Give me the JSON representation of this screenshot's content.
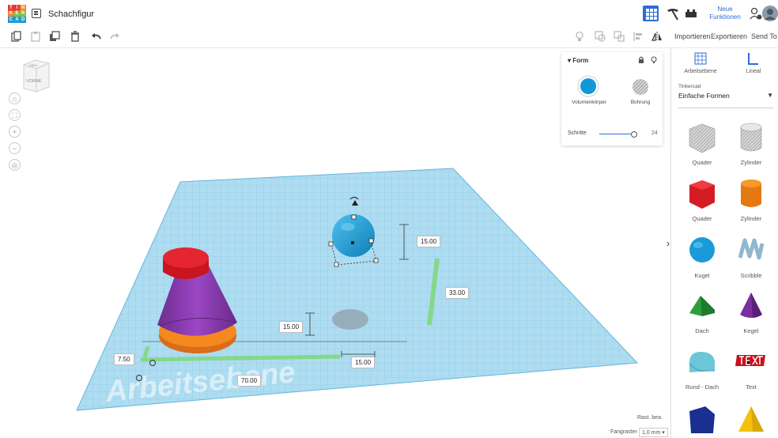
{
  "app": {
    "logo_letters": [
      "T",
      "I",
      "N",
      "K",
      "E",
      "R",
      "C",
      "A",
      "D"
    ],
    "logo_colors": [
      "#e63935",
      "#e63935",
      "#f58220",
      "#f58220",
      "#7cc242",
      "#7cc242",
      "#1e9ad6",
      "#1e9ad6",
      "#1e9ad6"
    ],
    "title": "Schachfigur"
  },
  "header": {
    "neue_funktionen_line1": "Neue",
    "neue_funktionen_line2": "Funktionen",
    "accent_color": "#2d6cd6"
  },
  "toolbar": {
    "import_label": "Importieren",
    "export_label": "Exportieren",
    "send_label": "Send To"
  },
  "viewcube": {
    "label_top": "OBEN",
    "label_front": "VORNE"
  },
  "workplane": {
    "watermark": "Arbeitsebene",
    "plane_color": "#aedcf0"
  },
  "dimensions": {
    "sphere_height": "15.00",
    "elevation": "33.00",
    "base_height": "15.00",
    "length": "70.00",
    "width_small": "15.00",
    "offset": "7.50"
  },
  "shape_panel": {
    "header": "Form",
    "solid_label": "Volumenkörper",
    "hole_label": "Bohrung",
    "steps_label": "Schritte",
    "steps_value": "24",
    "steps_level": 0.75
  },
  "sidebar": {
    "workplane_label": "Arbeitsebene",
    "ruler_label": "Lineal",
    "library_caption": "Tinkercad",
    "library_value": "Einfache Formen",
    "shapes": [
      {
        "label": "Quader",
        "icon": "box-hole-icon"
      },
      {
        "label": "Zylinder",
        "icon": "cylinder-hole-icon"
      },
      {
        "label": "Quader",
        "icon": "box-icon"
      },
      {
        "label": "Zylinder",
        "icon": "cylinder-icon"
      },
      {
        "label": "Kugel",
        "icon": "sphere-icon"
      },
      {
        "label": "Scribble",
        "icon": "scribble-icon"
      },
      {
        "label": "Dach",
        "icon": "roof-icon"
      },
      {
        "label": "Kegel",
        "icon": "cone-icon"
      },
      {
        "label": "Rund - Dach",
        "icon": "round-roof-icon"
      },
      {
        "label": "Text",
        "icon": "text-icon"
      }
    ]
  },
  "statusbar": {
    "grid_edit": "Rast. bea.",
    "snap_label": "Fangraster",
    "snap_value": "1,0 mm"
  }
}
